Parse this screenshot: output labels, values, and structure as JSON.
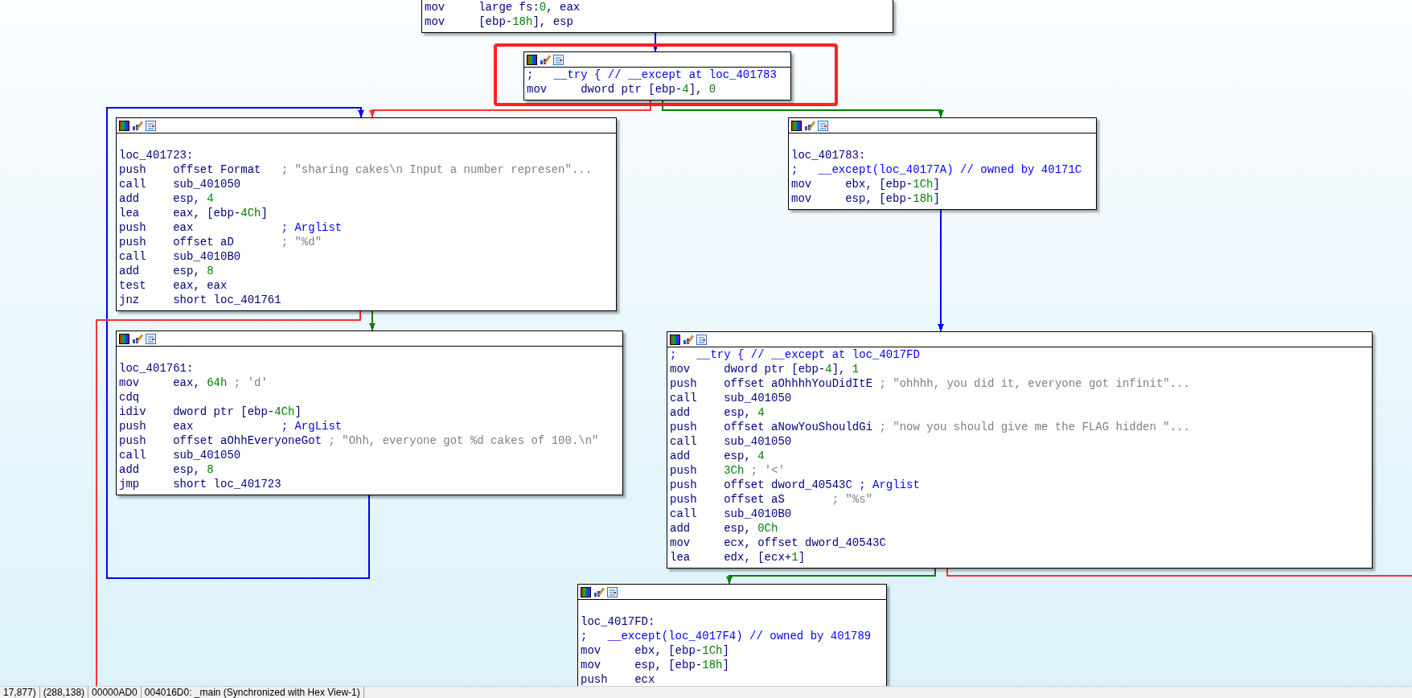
{
  "graph": {
    "nodes": [
      {
        "kind": "cut",
        "highlighted": false,
        "lines": [
          [
            {
              "text": "mov     large fs:",
              "kind": "operand"
            },
            {
              "text": "0",
              "kind": "number"
            },
            {
              "text": ", eax",
              "kind": "operand"
            }
          ],
          [
            {
              "text": "mov     [ebp-",
              "kind": "operand"
            },
            {
              "text": "18h",
              "kind": "number"
            },
            {
              "text": "], esp",
              "kind": "operand"
            }
          ]
        ]
      },
      {
        "kind": "plain",
        "highlighted": true,
        "lines": [
          [
            {
              "text": ";   __try { // __except at loc_401783",
              "kind": "note"
            }
          ],
          [
            {
              "text": "mov     dword ptr [ebp-",
              "kind": "operand"
            },
            {
              "text": "4",
              "kind": "number"
            },
            {
              "text": "], ",
              "kind": "operand"
            },
            {
              "text": "0",
              "kind": "number"
            }
          ]
        ]
      },
      {
        "kind": "labelled",
        "highlighted": false,
        "lines": [
          [
            {
              "text": "loc_401723:",
              "kind": "operand"
            }
          ],
          [
            {
              "text": "push    offset Format   ",
              "kind": "operand"
            },
            {
              "text": "; \"sharing cakes\\n Input a number represen\"...",
              "kind": "comment"
            }
          ],
          [
            {
              "text": "call    sub_401050",
              "kind": "operand"
            }
          ],
          [
            {
              "text": "add     esp, ",
              "kind": "operand"
            },
            {
              "text": "4",
              "kind": "number"
            }
          ],
          [
            {
              "text": "lea     eax, [ebp-",
              "kind": "operand"
            },
            {
              "text": "4Ch",
              "kind": "number"
            },
            {
              "text": "]",
              "kind": "operand"
            }
          ],
          [
            {
              "text": "push    eax             ",
              "kind": "operand"
            },
            {
              "text": "; Arglist",
              "kind": "note"
            }
          ],
          [
            {
              "text": "push    offset aD       ",
              "kind": "operand"
            },
            {
              "text": "; \"%d\"",
              "kind": "comment"
            }
          ],
          [
            {
              "text": "call    sub_4010B0",
              "kind": "operand"
            }
          ],
          [
            {
              "text": "add     esp, ",
              "kind": "operand"
            },
            {
              "text": "8",
              "kind": "number"
            }
          ],
          [
            {
              "text": "test    eax, eax",
              "kind": "operand"
            }
          ],
          [
            {
              "text": "jnz     short loc_401761",
              "kind": "operand"
            }
          ]
        ]
      },
      {
        "kind": "labelled",
        "highlighted": false,
        "lines": [
          [
            {
              "text": "loc_401783:",
              "kind": "operand"
            }
          ],
          [
            {
              "text": ";   __except(loc_40177A) // owned by 40171C",
              "kind": "note"
            }
          ],
          [
            {
              "text": "mov     ebx, [ebp-",
              "kind": "operand"
            },
            {
              "text": "1Ch",
              "kind": "number"
            },
            {
              "text": "]",
              "kind": "operand"
            }
          ],
          [
            {
              "text": "mov     esp, [ebp-",
              "kind": "operand"
            },
            {
              "text": "18h",
              "kind": "number"
            },
            {
              "text": "]",
              "kind": "operand"
            }
          ]
        ]
      },
      {
        "kind": "labelled",
        "highlighted": false,
        "lines": [
          [
            {
              "text": "loc_401761:",
              "kind": "operand"
            }
          ],
          [
            {
              "text": "mov     eax, ",
              "kind": "operand"
            },
            {
              "text": "64h",
              "kind": "number"
            },
            {
              "text": " ; 'd'",
              "kind": "comment"
            }
          ],
          [
            {
              "text": "cdq",
              "kind": "operand"
            }
          ],
          [
            {
              "text": "idiv    dword ptr [ebp-",
              "kind": "operand"
            },
            {
              "text": "4Ch",
              "kind": "number"
            },
            {
              "text": "]",
              "kind": "operand"
            }
          ],
          [
            {
              "text": "push    eax             ",
              "kind": "operand"
            },
            {
              "text": "; ArgList",
              "kind": "note"
            }
          ],
          [
            {
              "text": "push    offset aOhhEveryoneGot ",
              "kind": "operand"
            },
            {
              "text": "; \"Ohh, everyone got %d cakes of 100.\\n\"",
              "kind": "comment"
            }
          ],
          [
            {
              "text": "call    sub_401050",
              "kind": "operand"
            }
          ],
          [
            {
              "text": "add     esp, ",
              "kind": "operand"
            },
            {
              "text": "8",
              "kind": "number"
            }
          ],
          [
            {
              "text": "jmp     short loc_401723",
              "kind": "operand"
            }
          ]
        ]
      },
      {
        "kind": "plain",
        "highlighted": false,
        "lines": [
          [
            {
              "text": ";   __try { // __except at loc_4017FD",
              "kind": "note"
            }
          ],
          [
            {
              "text": "mov     dword ptr [ebp-",
              "kind": "operand"
            },
            {
              "text": "4",
              "kind": "number"
            },
            {
              "text": "], ",
              "kind": "operand"
            },
            {
              "text": "1",
              "kind": "number"
            }
          ],
          [
            {
              "text": "push    offset aOhhhhYouDidItE ",
              "kind": "operand"
            },
            {
              "text": "; \"ohhhh, you did it, everyone got infinit\"...",
              "kind": "comment"
            }
          ],
          [
            {
              "text": "call    sub_401050",
              "kind": "operand"
            }
          ],
          [
            {
              "text": "add     esp, ",
              "kind": "operand"
            },
            {
              "text": "4",
              "kind": "number"
            }
          ],
          [
            {
              "text": "push    offset aNowYouShouldGi ",
              "kind": "operand"
            },
            {
              "text": "; \"now you should give me the FLAG hidden \"...",
              "kind": "comment"
            }
          ],
          [
            {
              "text": "call    sub_401050",
              "kind": "operand"
            }
          ],
          [
            {
              "text": "add     esp, ",
              "kind": "operand"
            },
            {
              "text": "4",
              "kind": "number"
            }
          ],
          [
            {
              "text": "push    ",
              "kind": "operand"
            },
            {
              "text": "3Ch",
              "kind": "number"
            },
            {
              "text": " ; '<'",
              "kind": "comment"
            }
          ],
          [
            {
              "text": "push    offset dword_40543C ",
              "kind": "operand"
            },
            {
              "text": "; Arglist",
              "kind": "note"
            }
          ],
          [
            {
              "text": "push    offset aS       ",
              "kind": "operand"
            },
            {
              "text": "; \"%s\"",
              "kind": "comment"
            }
          ],
          [
            {
              "text": "call    sub_4010B0",
              "kind": "operand"
            }
          ],
          [
            {
              "text": "add     esp, ",
              "kind": "operand"
            },
            {
              "text": "0Ch",
              "kind": "number"
            }
          ],
          [
            {
              "text": "mov     ecx, offset dword_40543C",
              "kind": "operand"
            }
          ],
          [
            {
              "text": "lea     edx, [ecx+",
              "kind": "operand"
            },
            {
              "text": "1",
              "kind": "number"
            },
            {
              "text": "]",
              "kind": "operand"
            }
          ]
        ]
      },
      {
        "kind": "labelled",
        "highlighted": false,
        "lines": [
          [
            {
              "text": "loc_4017FD:",
              "kind": "operand"
            }
          ],
          [
            {
              "text": ";   __except(loc_4017F4) // owned by 401789",
              "kind": "note"
            }
          ],
          [
            {
              "text": "mov     ebx, [ebp-",
              "kind": "operand"
            },
            {
              "text": "1Ch",
              "kind": "number"
            },
            {
              "text": "]",
              "kind": "operand"
            }
          ],
          [
            {
              "text": "mov     esp, [ebp-",
              "kind": "operand"
            },
            {
              "text": "18h",
              "kind": "number"
            },
            {
              "text": "]",
              "kind": "operand"
            }
          ],
          [
            {
              "text": "push    ecx",
              "kind": "operand"
            }
          ]
        ]
      }
    ],
    "edges": [
      {
        "color": "#0000ff"
      },
      {
        "color": "#ff3030"
      },
      {
        "color": "#008000"
      },
      {
        "color": "#0000ff"
      },
      {
        "color": "#ff3030"
      },
      {
        "color": "#008000"
      },
      {
        "color": "#0000ff"
      },
      {
        "color": "#008000"
      },
      {
        "color": "#ff3030"
      }
    ]
  },
  "status_bar": [
    "17,877)",
    "(288,138)",
    "00000AD0",
    "004016D0: _main (Synchronized with Hex View-1)"
  ]
}
